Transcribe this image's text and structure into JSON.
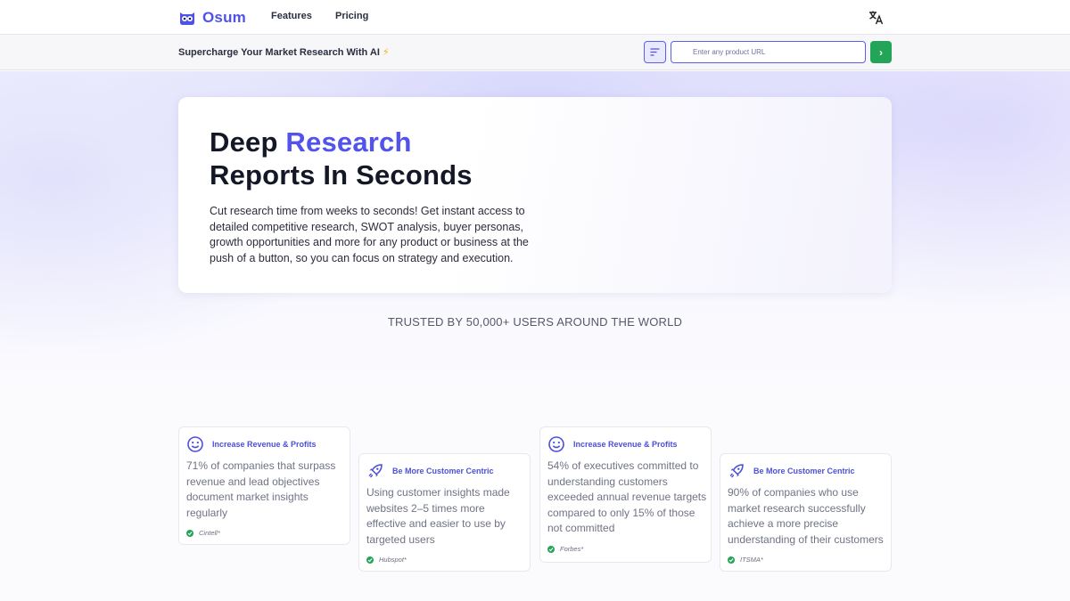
{
  "nav": {
    "brand": "Osum",
    "links": [
      "Features",
      "Pricing"
    ]
  },
  "searchbar": {
    "tagline": "Supercharge Your Market Research With AI",
    "tagline_emoji": "⚡",
    "url_placeholder": "Enter any product URL",
    "go_symbol": "›"
  },
  "hero": {
    "title_part1": "Deep ",
    "title_accent": "Research",
    "title_line2": "Reports In Seconds",
    "description": "Cut research time from weeks to seconds! Get instant access to detailed competitive research, SWOT analysis, buyer personas, growth opportunities and more for any product or business at the push of a button, so you can focus on strategy and execution."
  },
  "trusted": "TRUSTED BY 50,000+ USERS AROUND THE WORLD",
  "stats": [
    {
      "icon": "smile-icon",
      "category": "Increase Revenue & Profits",
      "text": "71% of companies that surpass revenue and lead objectives document market insights regularly",
      "source": "Cintell*"
    },
    {
      "icon": "rocket-icon",
      "category": "Be More Customer Centric",
      "text": "Using customer insights made websites 2–5 times more effective and easier to use by targeted users",
      "source": "Hubspot*"
    },
    {
      "icon": "smile-icon",
      "category": "Increase Revenue & Profits",
      "text": "54% of executives committed to understanding customers exceeded annual revenue targets compared to only 15% of those not committed",
      "source": "Forbes*"
    },
    {
      "icon": "rocket-icon",
      "category": "Be More Customer Centric",
      "text": "90% of companies who use market research successfully achieve a more precise understanding of their customers",
      "source": "ITSMA*"
    }
  ],
  "colors": {
    "accent": "#5153ea",
    "go_button": "#22a559",
    "check": "#22a559"
  }
}
